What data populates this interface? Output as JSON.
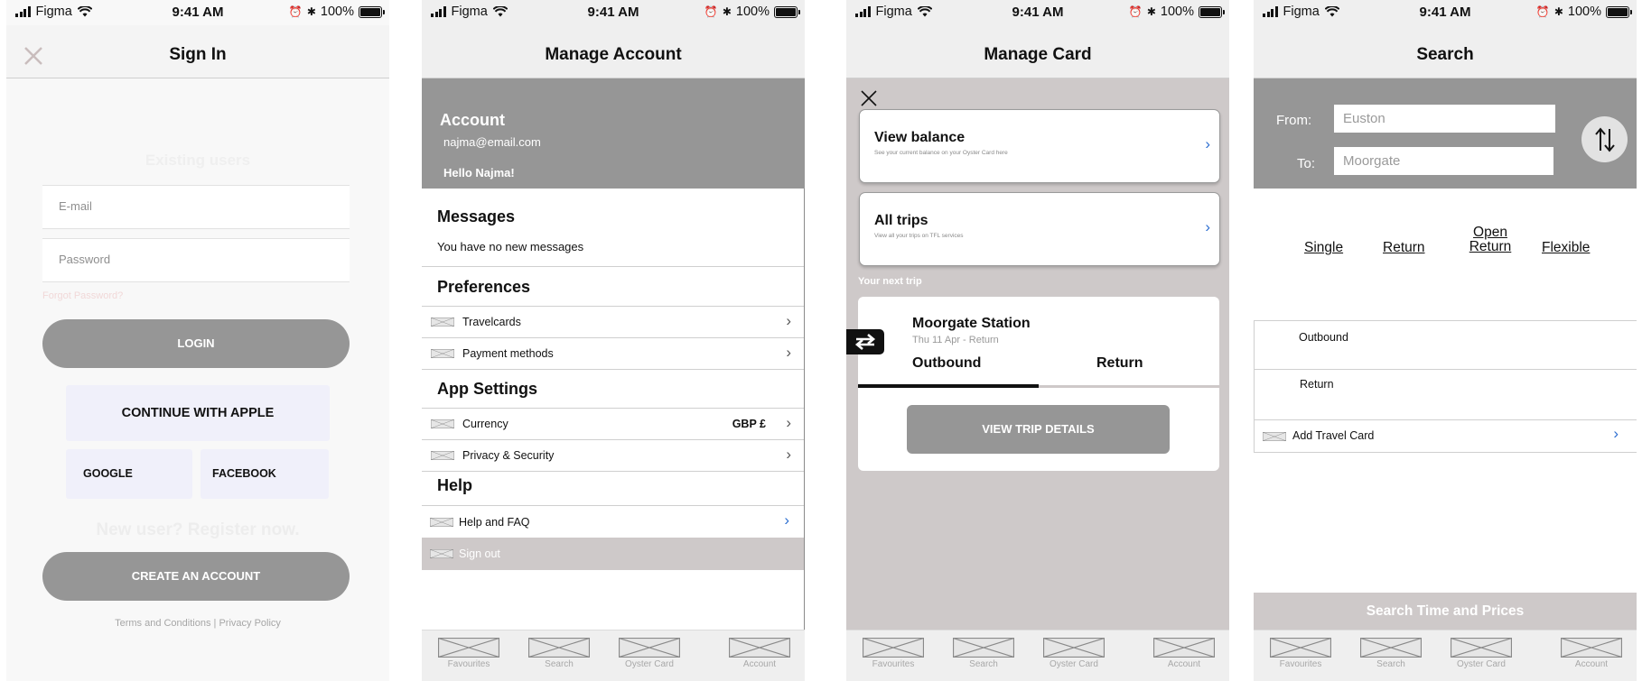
{
  "status_bar": {
    "carrier": "Figma",
    "time": "9:41 AM",
    "battery": "100%"
  },
  "signin": {
    "title": "Sign In",
    "existing_users": "Existing users",
    "email_placeholder": "E-mail",
    "password_placeholder": "Password",
    "forgot_password": "Forgot Password?",
    "login": "LOGIN",
    "continue_apple": "CONTINUE WITH APPLE",
    "google": "GOOGLE",
    "facebook": "FACEBOOK",
    "new_user": "New user? Register now.",
    "create_account": "CREATE AN ACCOUNT",
    "terms": "Terms and Conditions",
    "separator": "|",
    "privacy": "Privacy Policy"
  },
  "account": {
    "title": "Manage Account",
    "heading": "Account",
    "email": "najma@email.com",
    "greeting": "Hello Najma!",
    "messages_heading": "Messages",
    "messages_text": "You have no new messages",
    "preferences_heading": "Preferences",
    "travelcards": "Travelcards",
    "payment_methods": "Payment methods",
    "app_settings_heading": "App Settings",
    "currency": "Currency",
    "currency_value": "GBP £",
    "privacy_security": "Privacy & Security",
    "help_heading": "Help",
    "help_faq": "Help and FAQ",
    "sign_out": "Sign out"
  },
  "card": {
    "title": "Manage Card",
    "view_balance": "View balance",
    "view_balance_sub": "See your current balance on your Oyster Card here",
    "all_trips": "All trips",
    "all_trips_sub": "View all your trips on TFL services",
    "next_trip_label": "Your next trip",
    "station": "Moorgate Station",
    "trip_date": "Thu 11 Apr - Return",
    "outbound_tab": "Outbound",
    "return_tab": "Return",
    "view_trip_details": "VIEW TRIP DETAILS"
  },
  "search": {
    "title": "Search",
    "from_label": "From:",
    "to_label": "To:",
    "from_value": "Euston",
    "to_value": "Moorgate",
    "ticket_types": [
      "Single",
      "Return",
      "Open\nReturn",
      "Flexible"
    ],
    "outbound": "Outbound",
    "return": "Return",
    "add_travel_card": "Add Travel Card",
    "search_button": "Search Time and Prices"
  },
  "tabs": [
    "Favourites",
    "Search",
    "Oyster Card",
    "Account"
  ],
  "colors": {
    "header_gray": "#969696",
    "button_gray": "#969696",
    "card_bg": "#cec9c9",
    "link_blue": "#2d6fd1"
  }
}
